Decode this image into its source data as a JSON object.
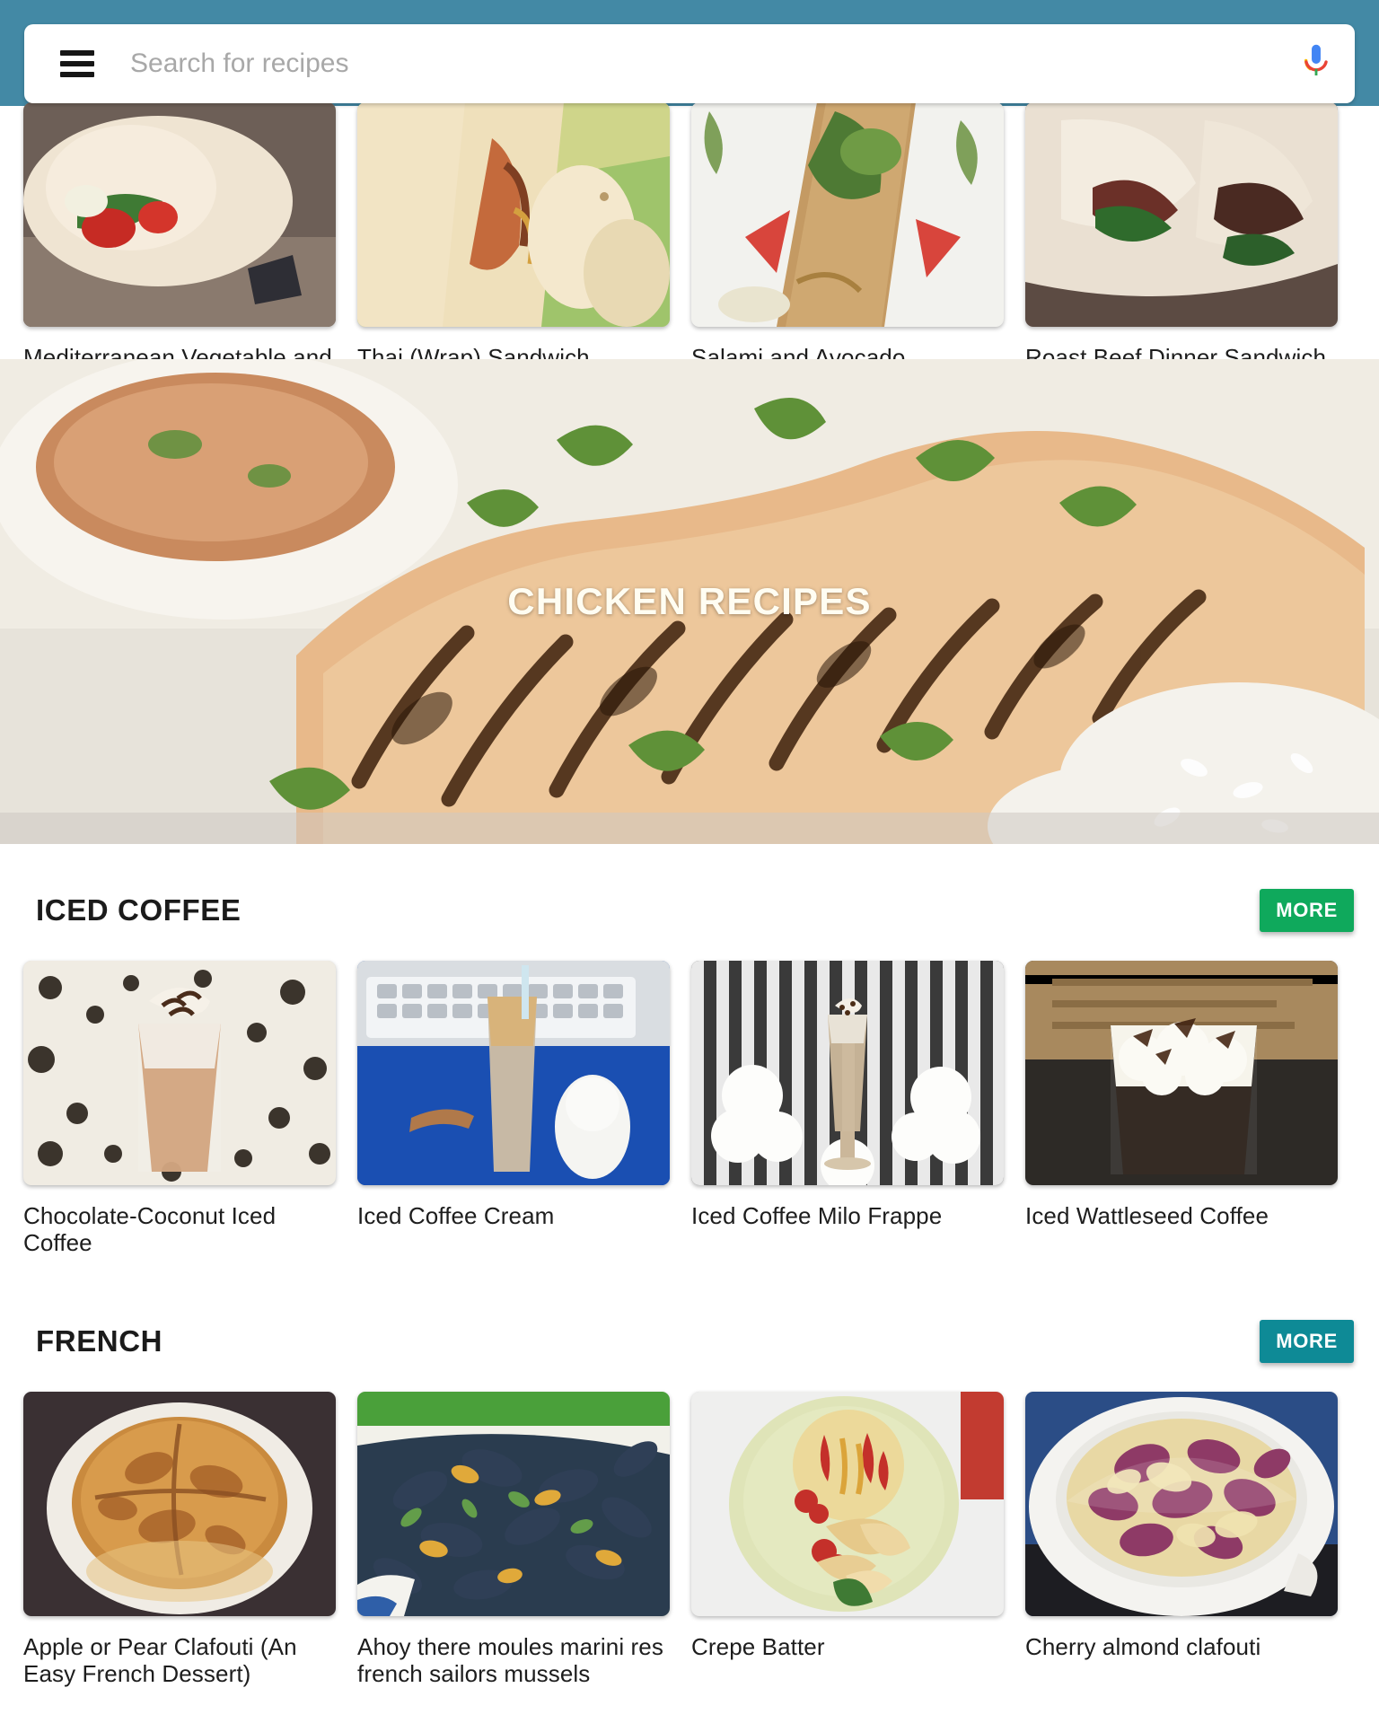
{
  "header": {
    "background_color": "#4389a5",
    "menu_icon": "hamburger-menu-icon",
    "mic_icon": "google-microphone-icon",
    "search_placeholder": "Search for recipes",
    "search_value": ""
  },
  "top_row": {
    "cards": [
      {
        "title": "Mediterranean Vegetable and Chicken Sandwich Wrap",
        "image": "wrap-with-spinach-and-red-pepper"
      },
      {
        "title": "Thai (Wrap) Sandwich",
        "image": "thai-wrap-on-green-plate"
      },
      {
        "title": "Salami and Avocado Sandwich Wrap With Balsamic",
        "image": "salami-avocado-wrap-on-floral-plate"
      },
      {
        "title": "Roast Beef Dinner Sandwich Wrap",
        "image": "roast-beef-wrap-closeup"
      }
    ]
  },
  "hero": {
    "title": "CHICKEN RECIPES",
    "image": "grilled-chicken-with-rice-and-sauce"
  },
  "sections": [
    {
      "title": "ICED COFFEE",
      "more_label": "MORE",
      "more_color": "#0fa95c",
      "cards": [
        {
          "title": "Chocolate-Coconut Iced Coffee",
          "image": "iced-coffee-on-patterned-cloth"
        },
        {
          "title": "Iced Coffee Cream",
          "image": "iced-coffee-beside-keyboard-and-mouse"
        },
        {
          "title": "Iced Coffee Milo Frappe",
          "image": "frappe-with-white-flowers"
        },
        {
          "title": "Iced Wattleseed Coffee",
          "image": "coffee-with-whipped-cream-and-chocolate"
        }
      ]
    },
    {
      "title": "FRENCH",
      "more_label": "MORE",
      "more_color": "#0e8a96",
      "cards": [
        {
          "title": "Apple or Pear Clafouti (An Easy French Dessert)",
          "image": "golden-clafouti-on-white-plate"
        },
        {
          "title": "Ahoy there moules marini res french sailors mussels",
          "image": "bowl-of-mussels"
        },
        {
          "title": "Crepe Batter",
          "image": "crepe-with-berries-on-green-plate"
        },
        {
          "title": "Cherry almond clafouti",
          "image": "cherry-clafouti-in-white-dish"
        }
      ]
    }
  ]
}
